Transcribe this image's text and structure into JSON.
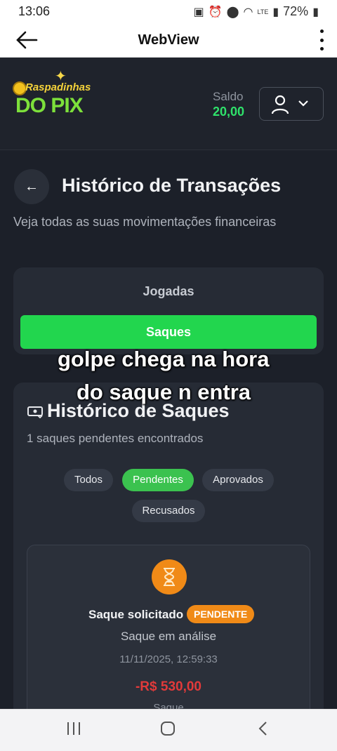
{
  "status_bar": {
    "time": "13:06",
    "battery": "72%",
    "network": "LTE"
  },
  "app_bar": {
    "title": "WebView"
  },
  "site_header": {
    "logo_line1": "Raspadinhas",
    "logo_line2": "DO PIX",
    "saldo_label": "Saldo",
    "saldo_value": "20,00"
  },
  "page": {
    "title": "Histórico de Transações",
    "subtitle": "Veja todas as suas movimentações financeiras"
  },
  "tabs": {
    "jogadas": "Jogadas",
    "saques": "Saques"
  },
  "overlay_caption": {
    "line1": "golpe  chega na hora",
    "line2": "do saque n entra"
  },
  "history": {
    "title": "Histórico de Saques",
    "count": "1 saques pendentes encontrados",
    "filters": [
      "Todos",
      "Pendentes",
      "Aprovados",
      "Recusados"
    ],
    "active_filter": "Pendentes"
  },
  "transaction": {
    "title": "Saque solicitado",
    "badge": "PENDENTE",
    "status": "Saque em análise",
    "datetime": "11/11/2025, 12:59:33",
    "amount": "-R$ 530,00",
    "type": "Saque"
  },
  "colors": {
    "accent_green": "#22d64e",
    "balance_green": "#2fe26b",
    "pending_orange": "#f08a17",
    "amount_red": "#e23a3a",
    "background": "#1c2029"
  }
}
